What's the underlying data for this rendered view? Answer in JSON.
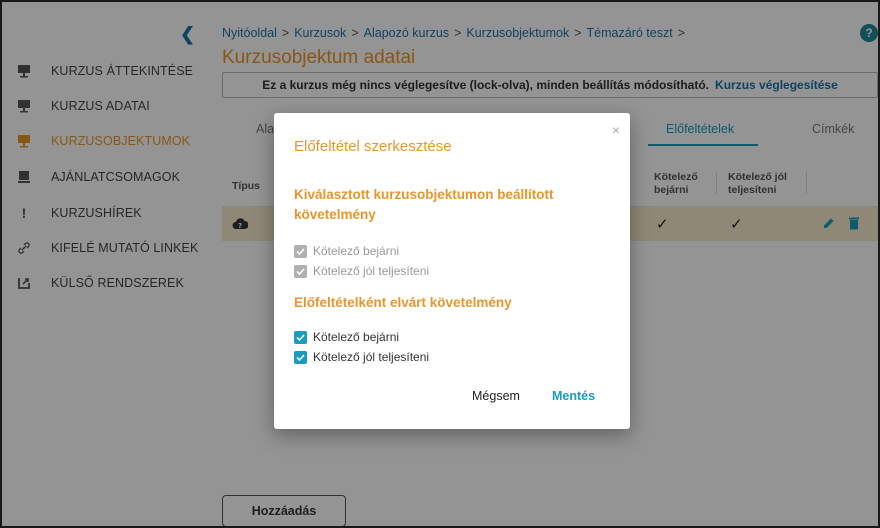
{
  "sidebar": {
    "items": [
      {
        "label": "KURZUS ÁTTEKINTÉSE",
        "icon": "presentation-icon",
        "active": false
      },
      {
        "label": "KURZUS ADATAI",
        "icon": "presentation-icon",
        "active": false
      },
      {
        "label": "KURZUSOBJEKTUMOK",
        "icon": "presentation-icon",
        "active": true
      },
      {
        "label": "AJÁNLATCSOMAGOK",
        "icon": "package-icon",
        "active": false
      },
      {
        "label": "KURZUSHÍREK",
        "icon": "exclamation-icon",
        "active": false
      },
      {
        "label": "KIFELÉ MUTATÓ LINKEK",
        "icon": "link-icon",
        "active": false
      },
      {
        "label": "KÜLSŐ RENDSZEREK",
        "icon": "external-icon",
        "active": false
      }
    ]
  },
  "breadcrumb": {
    "items": [
      "Nyitóoldal",
      "Kurzusok",
      "Alapozó kurzus",
      "Kurzusobjektumok",
      "Témazáró teszt"
    ],
    "separator": ">"
  },
  "help": "?",
  "page_title": "Kurzusobjektum adatai",
  "lock_banner": {
    "text": "Ez a kurzus még nincs véglegesítve (lock-olva), minden beállítás módosítható.",
    "link": "Kurzus véglegesítése"
  },
  "tabs": [
    "Ala",
    "Előfeltételek",
    "Címkék"
  ],
  "table": {
    "headers": [
      "Típus",
      "Kötelező bejárni",
      "Kötelező jól teljesíteni"
    ],
    "row": {
      "check1": "✓",
      "check2": "✓"
    }
  },
  "add_button": "Hozzáadás",
  "modal": {
    "title": "Előfeltétel szerkesztése",
    "close": "×",
    "section1": {
      "title": "Kiválasztott kurzusobjektumon beállított követelmény",
      "options": [
        "Kötelező bejárni",
        "Kötelező jól teljesíteni"
      ]
    },
    "section2": {
      "title": "Előfeltételként elvárt követelmény",
      "options": [
        "Kötelező bejárni",
        "Kötelező jól teljesíteni"
      ]
    },
    "cancel": "Mégsem",
    "save": "Mentés"
  },
  "colors": {
    "accent_orange": "#e8962a",
    "accent_blue": "#1a9bc0",
    "link_blue": "#1a73a8"
  }
}
